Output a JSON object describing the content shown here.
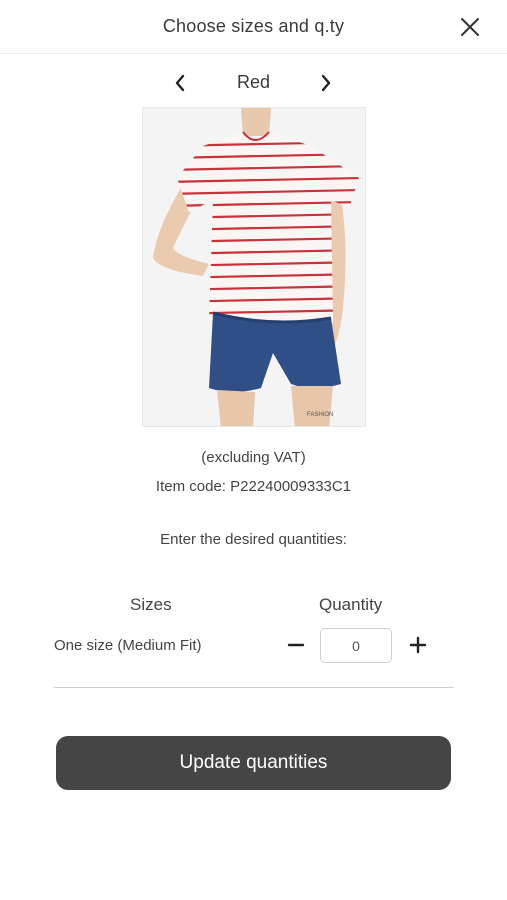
{
  "header": {
    "title": "Choose sizes and q.ty",
    "close_icon": "close-icon"
  },
  "color_nav": {
    "prev_icon": "chevron-left-icon",
    "label": "Red",
    "next_icon": "chevron-right-icon"
  },
  "product": {
    "image_desc": "red-striped-tshirt-denim-shorts-photo",
    "watermark": "FASHION"
  },
  "info": {
    "vat": "(excluding VAT)",
    "item_code": "Item code: P22240009333C1",
    "instruction": "Enter the desired quantities:"
  },
  "table": {
    "sizes_header": "Sizes",
    "quantity_header": "Quantity",
    "rows": [
      {
        "size": "One size (Medium Fit)",
        "quantity": "0"
      }
    ]
  },
  "actions": {
    "update_label": "Update quantities"
  },
  "colors": {
    "button_bg": "#454545",
    "stripe": "#c8333a",
    "denim": "#2f4f86"
  }
}
